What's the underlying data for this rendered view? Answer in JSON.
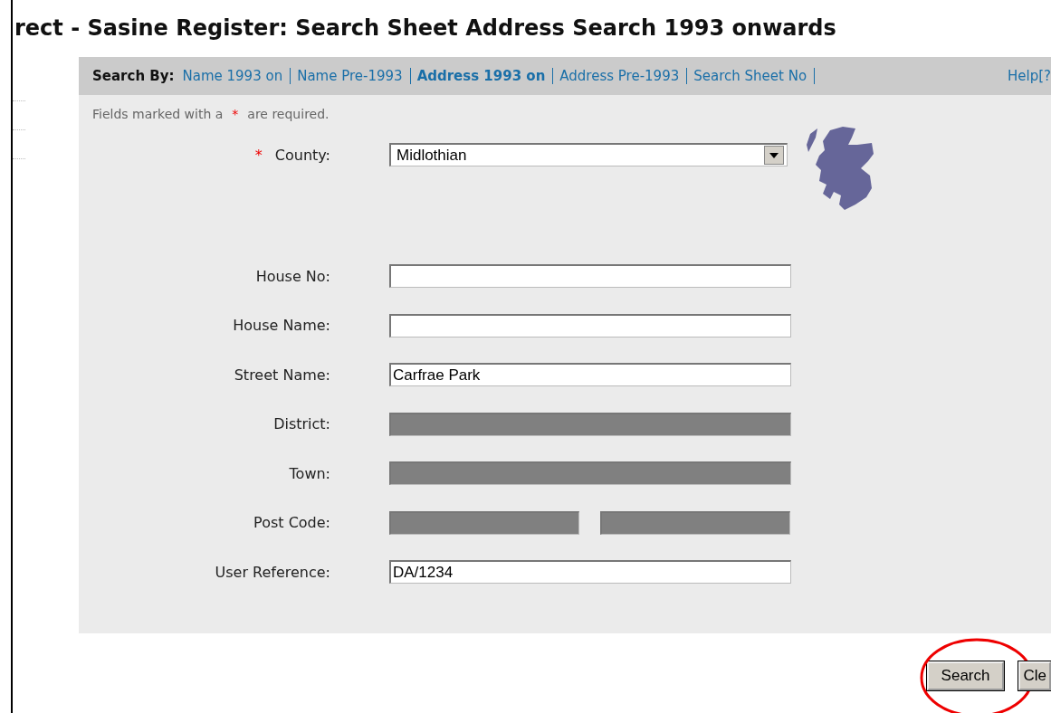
{
  "title": "rect - Sasine Register: Search Sheet Address Search 1993 onwards",
  "search_by": {
    "label": "Search By:",
    "links": [
      {
        "label": "Name 1993 on",
        "selected": false
      },
      {
        "label": "Name Pre-1993",
        "selected": false
      },
      {
        "label": "Address 1993 on",
        "selected": true
      },
      {
        "label": "Address Pre-1993",
        "selected": false
      },
      {
        "label": "Search Sheet No",
        "selected": false
      }
    ],
    "help": "Help[?"
  },
  "required_note": {
    "before": "Fields marked with a",
    "mark": "*",
    "after": "are required."
  },
  "fields": [
    {
      "label": "County:",
      "required": true,
      "kind": "select",
      "value": "Midlothian",
      "disabled": false
    },
    {
      "label": "House No:",
      "required": false,
      "kind": "text",
      "disabled": false
    },
    {
      "label": "House Name:",
      "required": false,
      "kind": "text",
      "disabled": false
    },
    {
      "label": "Street Name:",
      "required": false,
      "kind": "text",
      "value": "Carfrae Park",
      "disabled": false
    },
    {
      "label": "District:",
      "required": false,
      "kind": "text",
      "disabled": true
    },
    {
      "label": "Town:",
      "required": false,
      "kind": "text",
      "disabled": true
    },
    {
      "label": "Post Code:",
      "required": false,
      "kind": "split",
      "disabled": true
    },
    {
      "label": "User Reference:",
      "required": false,
      "kind": "text",
      "value": "DA/1234",
      "disabled": false
    }
  ],
  "buttons": [
    {
      "label": "Search",
      "highlighted": true
    },
    {
      "label": "Cle",
      "highlighted": false
    }
  ]
}
